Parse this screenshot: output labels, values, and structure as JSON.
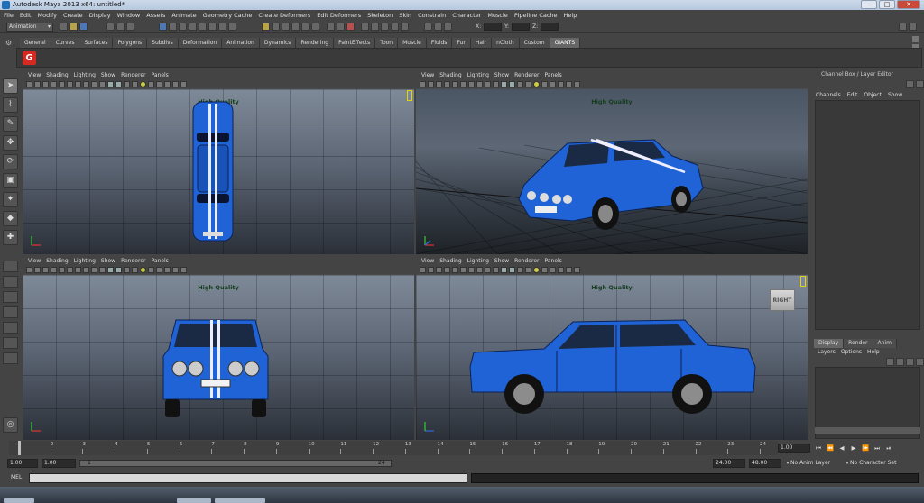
{
  "window": {
    "title": "Autodesk Maya 2013 x64: untitled*"
  },
  "menubar": [
    "File",
    "Edit",
    "Modify",
    "Create",
    "Display",
    "Window",
    "Assets",
    "Animate",
    "Geometry Cache",
    "Create Deformers",
    "Edit Deformers",
    "Skeleton",
    "Skin",
    "Constrain",
    "Character",
    "Muscle",
    "Pipeline Cache",
    "Help"
  ],
  "statusline": {
    "mode": "Animation",
    "x_label": "X:",
    "y_label": "Y:",
    "z_label": "Z:"
  },
  "shelf": {
    "tabs": [
      "General",
      "Curves",
      "Surfaces",
      "Polygons",
      "Subdivs",
      "Deformation",
      "Animation",
      "Dynamics",
      "Rendering",
      "PaintEffects",
      "Toon",
      "Muscle",
      "Fluids",
      "Fur",
      "Hair",
      "nCloth",
      "Custom",
      "GIANTS"
    ],
    "active_tab": "GIANTS",
    "button_label": "G"
  },
  "viewport_menu": [
    "View",
    "Shading",
    "Lighting",
    "Show",
    "Renderer",
    "Panels"
  ],
  "viewports": {
    "top": {
      "hq": "High Quality"
    },
    "persp": {
      "hq": "High Quality"
    },
    "front": {
      "hq": "High Quality"
    },
    "side": {
      "hq": "High Quality",
      "cube_label": "RIGHT"
    }
  },
  "channelbox": {
    "title": "Channel Box / Layer Editor",
    "menu": [
      "Channels",
      "Edit",
      "Object",
      "Show"
    ],
    "tabs": [
      "Display",
      "Render",
      "Anim"
    ],
    "active_tab": "Display",
    "layer_menu": [
      "Layers",
      "Options",
      "Help"
    ]
  },
  "timeslider": {
    "frames": [
      "1",
      "2",
      "3",
      "4",
      "5",
      "6",
      "7",
      "8",
      "9",
      "10",
      "11",
      "12",
      "13",
      "14",
      "15",
      "16",
      "17",
      "18",
      "19",
      "20",
      "21",
      "22",
      "23",
      "24"
    ],
    "current_frame": "1.00",
    "playback": [
      "⏮",
      "⏪",
      "◀",
      "▶",
      "⏩",
      "⏭",
      "⏯"
    ]
  },
  "rangeslider": {
    "start": "1.00",
    "inner_start": "1.00",
    "bar_start": "1",
    "bar_end": "24",
    "end": "24.00",
    "outer_end": "48.00",
    "anim_layer": "No Anim Layer",
    "character_set": "No Character Set"
  },
  "cmdline": {
    "label": "MEL"
  },
  "colors": {
    "car_blue": "#1f63d6",
    "hq_text": "#143e1a",
    "giants_red": "#d42a22"
  }
}
